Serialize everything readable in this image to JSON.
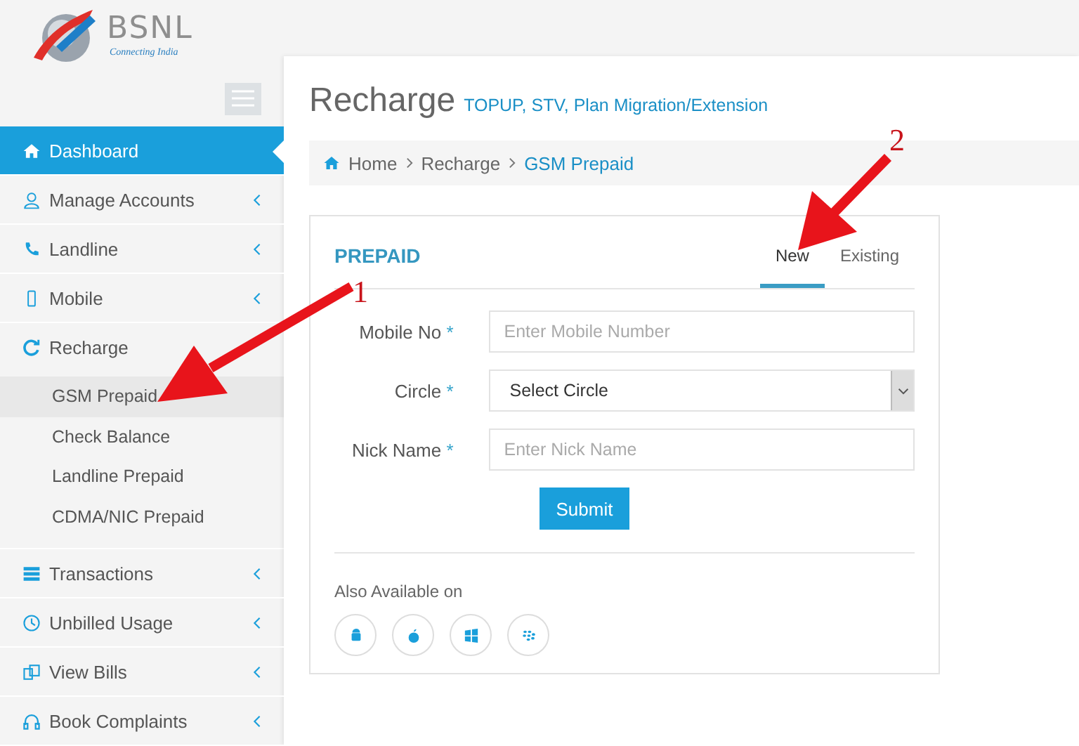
{
  "logo": {
    "name": "BSNL",
    "tagline": "Connecting India"
  },
  "sidebar": {
    "items": [
      {
        "label": "Dashboard",
        "selected": true,
        "chevron": false
      },
      {
        "label": "Manage Accounts",
        "selected": false,
        "chevron": true
      },
      {
        "label": "Landline",
        "selected": false,
        "chevron": true
      },
      {
        "label": "Mobile",
        "selected": false,
        "chevron": true
      },
      {
        "label": "Recharge",
        "selected": false,
        "chevron": false,
        "expanded": true,
        "children": [
          {
            "label": "GSM Prepaid",
            "selected": true
          },
          {
            "label": "Check Balance",
            "selected": false
          },
          {
            "label": "Landline Prepaid",
            "selected": false
          },
          {
            "label": "CDMA/NIC Prepaid",
            "selected": false
          }
        ]
      },
      {
        "label": "Transactions",
        "selected": false,
        "chevron": true
      },
      {
        "label": "Unbilled Usage",
        "selected": false,
        "chevron": true
      },
      {
        "label": "View Bills",
        "selected": false,
        "chevron": true
      },
      {
        "label": "Book Complaints",
        "selected": false,
        "chevron": true
      }
    ]
  },
  "page": {
    "title": "Recharge",
    "subtitle": "TOPUP, STV, Plan Migration/Extension"
  },
  "breadcrumb": [
    "Home",
    "Recharge",
    "GSM Prepaid"
  ],
  "card": {
    "title": "PREPAID",
    "tabs": [
      {
        "label": "New",
        "selected": true
      },
      {
        "label": "Existing",
        "selected": false
      }
    ],
    "fields": [
      {
        "label": "Mobile No",
        "required": "*",
        "kind": "input",
        "placeholder": "Enter Mobile Number"
      },
      {
        "label": "Circle",
        "required": "*",
        "kind": "select",
        "value": "Select Circle"
      },
      {
        "label": "Nick Name",
        "required": "*",
        "kind": "input",
        "placeholder": "Enter Nick Name"
      }
    ],
    "submit": "Submit",
    "also_available": "Also Available on"
  },
  "annotations": [
    {
      "label": "1"
    },
    {
      "label": "2"
    }
  ]
}
